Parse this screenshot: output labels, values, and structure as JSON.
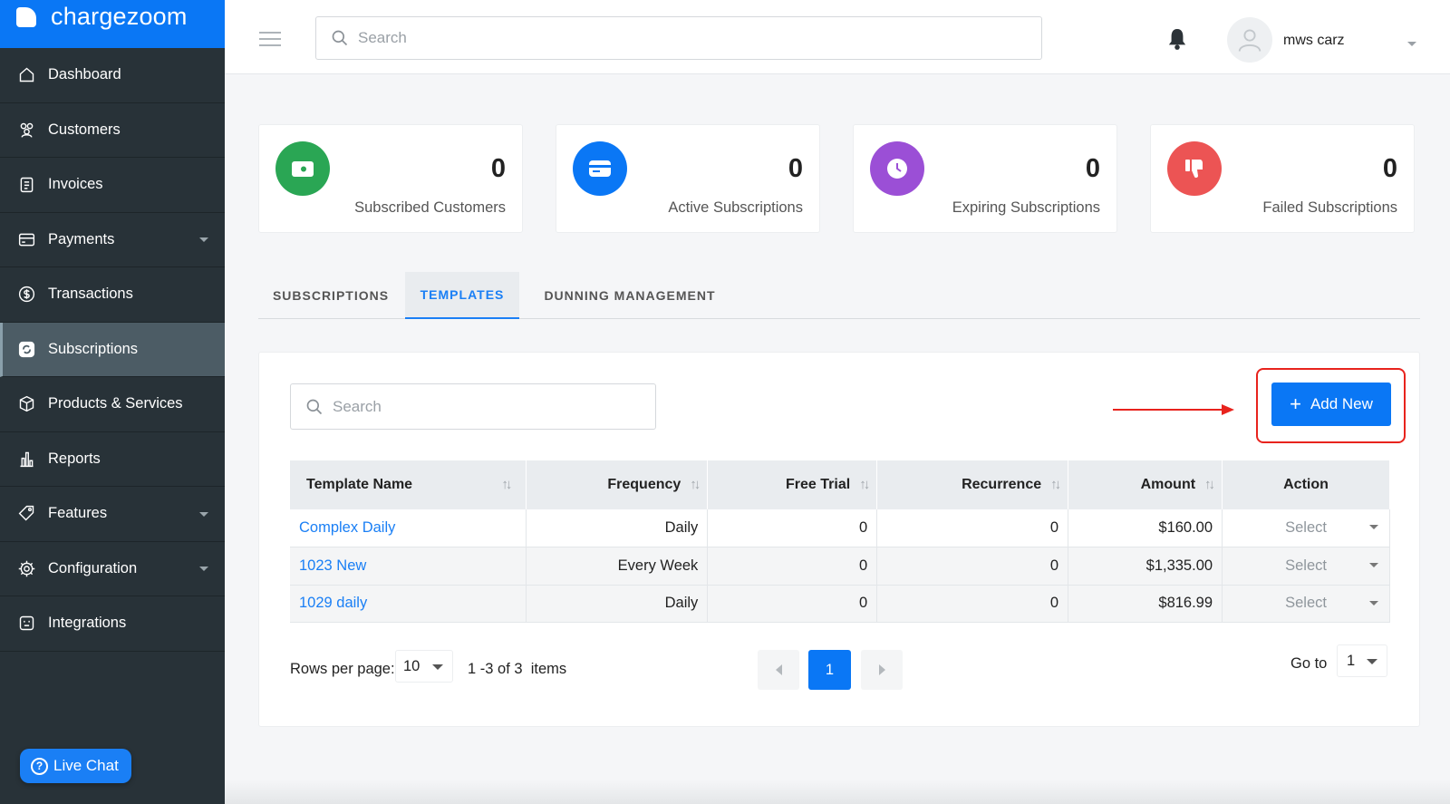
{
  "brand": {
    "name": "chargezoom"
  },
  "sidebar": {
    "items": [
      {
        "label": "Dashboard",
        "icon": "home-icon"
      },
      {
        "label": "Customers",
        "icon": "users-icon"
      },
      {
        "label": "Invoices",
        "icon": "clipboard-icon"
      },
      {
        "label": "Payments",
        "icon": "card-icon",
        "caret": true
      },
      {
        "label": "Transactions",
        "icon": "dollar-icon"
      },
      {
        "label": "Subscriptions",
        "icon": "refresh-icon",
        "active": true
      },
      {
        "label": "Products & Services",
        "icon": "box-icon"
      },
      {
        "label": "Reports",
        "icon": "bar-chart-icon"
      },
      {
        "label": "Features",
        "icon": "tag-icon",
        "caret": true
      },
      {
        "label": "Configuration",
        "icon": "gear-icon",
        "caret": true
      },
      {
        "label": "Integrations",
        "icon": "plug-icon"
      }
    ],
    "live_chat": "Live Chat"
  },
  "header": {
    "search_placeholder": "Search",
    "username": "mws carz"
  },
  "stats": [
    {
      "value": "0",
      "label": "Subscribed Customers",
      "color": "#2aa654",
      "icon": "wallet-icon"
    },
    {
      "value": "0",
      "label": "Active Subscriptions",
      "color": "#0a77f5",
      "icon": "credit-card-icon"
    },
    {
      "value": "0",
      "label": "Expiring Subscriptions",
      "color": "#9b4fd6",
      "icon": "clock-icon"
    },
    {
      "value": "0",
      "label": "Failed Subscriptions",
      "color": "#ec5454",
      "icon": "thumbs-down-icon"
    }
  ],
  "tabs": [
    {
      "label": "SUBSCRIPTIONS"
    },
    {
      "label": "TEMPLATES",
      "active": true
    },
    {
      "label": "DUNNING MANAGEMENT"
    }
  ],
  "templates": {
    "search_placeholder": "Search",
    "add_new": "Add New",
    "columns": [
      "Template Name",
      "Frequency",
      "Free Trial",
      "Recurrence",
      "Amount",
      "Action"
    ],
    "rows": [
      {
        "name": "Complex Daily",
        "frequency": "Daily",
        "free_trial": "0",
        "recurrence": "0",
        "amount": "$160.00",
        "action": "Select"
      },
      {
        "name": "1023 New",
        "frequency": "Every Week",
        "free_trial": "0",
        "recurrence": "0",
        "amount": "$1,335.00",
        "action": "Select"
      },
      {
        "name": "1029 daily",
        "frequency": "Daily",
        "free_trial": "0",
        "recurrence": "0",
        "amount": "$816.99",
        "action": "Select"
      }
    ],
    "pagination": {
      "rows_label": "Rows per page:",
      "rows_value": "10",
      "items_label": "1 -3 of 3  items",
      "current_page": "1",
      "goto_label": "Go to",
      "goto_value": "1"
    }
  },
  "colors": {
    "accent": "#0a77f5",
    "sidebar": "#283238",
    "highlight": "#e8231d"
  }
}
